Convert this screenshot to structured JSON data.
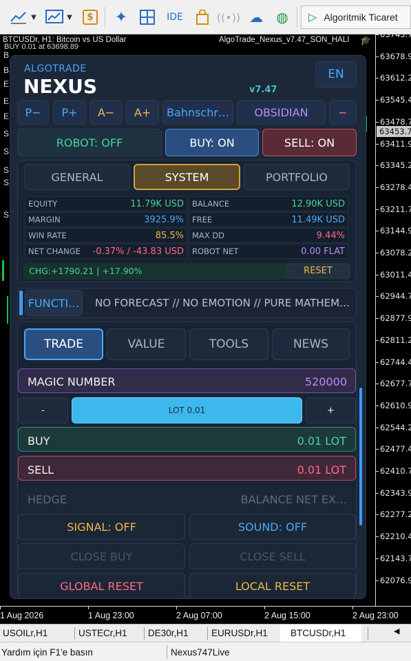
{
  "toolbar": {
    "ide_label": "IDE",
    "algo_trading_label": "Algoritmik Ticaret",
    "icons": [
      "line-chart-icon",
      "chevron-down-icon",
      "chart-template-icon",
      "chevron-down-icon",
      "dollar-icon",
      "sparkle-icon",
      "grid-icon",
      "ide-icon",
      "shopping-bag-icon",
      "signal-icon",
      "cloud-icon",
      "vps-icon",
      "play-icon"
    ]
  },
  "chart": {
    "symbol_line": "BTCUSDr, H1:  Bitcoin vs US Dollar",
    "ea_name": "AlgoTrade_Nexus_v7.47_SON_HALI",
    "buy_at": "BUY 0.01 at 63698.89",
    "current_price": "63453.7",
    "price_ticks": [
      "63745.7",
      "63678.9",
      "63612.2",
      "63545.4",
      "63478.7",
      "63411.9",
      "63345.2",
      "63278.4",
      "63211.7",
      "63144.9",
      "63078.2",
      "63011.4",
      "62944.7",
      "62877.9",
      "62811.2",
      "62744.4",
      "62677.7",
      "62610.9",
      "62544.2",
      "62477.4",
      "62410.7",
      "62343.9",
      "62277.2",
      "62210.4",
      "62143.7",
      "62076.9"
    ],
    "time_ticks": [
      "1 Aug 2026",
      "1 Aug 23:00",
      "2 Aug 07:00",
      "2 Aug 15:00",
      "2 Aug 23:00"
    ],
    "edge_letters": [
      "B",
      "B",
      "E",
      "E",
      "E",
      "S",
      "S",
      "S",
      "S",
      "S"
    ]
  },
  "panel": {
    "brand_small": "ALGOTRADE",
    "brand_big": "NEXUS",
    "version": "v7.47",
    "language": "EN",
    "buttons_row1": [
      "P−",
      "P+",
      "A−",
      "A+",
      "Bahnschr…",
      "OBSIDIAN",
      "−"
    ],
    "robot": "ROBOT: OFF",
    "buy_on": "BUY: ON",
    "sell_on": "SELL: ON",
    "tabs1": [
      "GENERAL",
      "SYSTEM",
      "PORTFOLIO"
    ],
    "active_tab1": "SYSTEM",
    "stats": [
      {
        "label": "EQUITY",
        "value": "11.79K USD",
        "color": "#47d39b"
      },
      {
        "label": "BALANCE",
        "value": "12.90K USD",
        "color": "#47d39b"
      },
      {
        "label": "MARGIN",
        "value": "3925.9%",
        "color": "#4aa8ff"
      },
      {
        "label": "FREE",
        "value": "11.49K USD",
        "color": "#4aa8ff"
      },
      {
        "label": "WIN RATE",
        "value": "85.5%",
        "color": "#f0b84a"
      },
      {
        "label": "MAX DD",
        "value": "9.44%",
        "color": "#ff6a85"
      },
      {
        "label": "NET CHANGE",
        "value": "-0.37% / -43.83 USD",
        "color": "#ff6a85"
      },
      {
        "label": "ROBOT NET",
        "value": "0.00 FLAT",
        "color": "#b58cff"
      }
    ],
    "chg": "CHG:+1790.21 | +17.90%",
    "reset": "RESET",
    "func": "FUNCTI…",
    "ticker": "NO FORECAST // NO EMOTION // PURE MATHEM…",
    "tabs2": [
      "TRADE",
      "VALUE",
      "TOOLS",
      "NEWS"
    ],
    "active_tab2": "TRADE",
    "magic_label": "MAGIC NUMBER",
    "magic_value": "520000",
    "minus": "-",
    "lot": "LOT 0.01",
    "plus": "+",
    "buy_label": "BUY",
    "buy_value": "0.01 LOT",
    "sell_label": "SELL",
    "sell_value": "0.01 LOT",
    "hedge_label": "HEDGE",
    "hedge_value": "BALANCE NET EX…",
    "signal": "SIGNAL: OFF",
    "sound": "SOUND: OFF",
    "close_buy": "CLOSE BUY",
    "close_sell": "CLOSE SELL",
    "global_reset": "GLOBAL RESET",
    "local_reset": "LOCAL RESET"
  },
  "symbol_tabs": [
    "USOILr,H1",
    "USTECr,H1",
    "DE30r,H1",
    "EURUSDr,H1",
    "BTCUSDr,H1"
  ],
  "active_symbol_tab": "BTCUSDr,H1",
  "status": {
    "help": "Yardım için F1'e basın",
    "profile": "Nexus747Live"
  }
}
